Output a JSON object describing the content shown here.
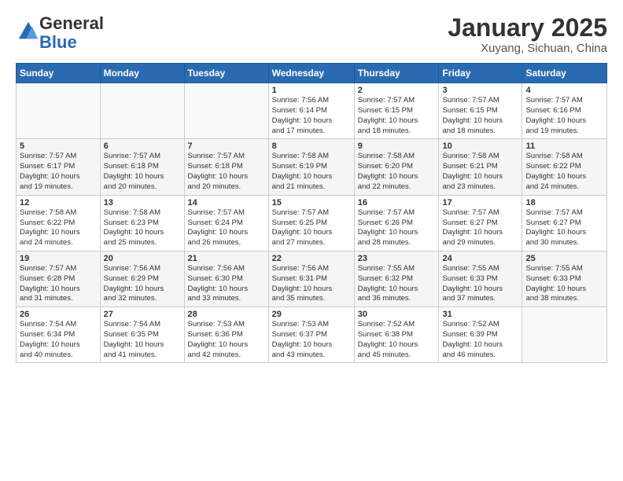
{
  "header": {
    "logo_general": "General",
    "logo_blue": "Blue",
    "title": "January 2025",
    "subtitle": "Xuyang, Sichuan, China"
  },
  "weekdays": [
    "Sunday",
    "Monday",
    "Tuesday",
    "Wednesday",
    "Thursday",
    "Friday",
    "Saturday"
  ],
  "weeks": [
    [
      {
        "day": "",
        "info": ""
      },
      {
        "day": "",
        "info": ""
      },
      {
        "day": "",
        "info": ""
      },
      {
        "day": "1",
        "info": "Sunrise: 7:56 AM\nSunset: 6:14 PM\nDaylight: 10 hours\nand 17 minutes."
      },
      {
        "day": "2",
        "info": "Sunrise: 7:57 AM\nSunset: 6:15 PM\nDaylight: 10 hours\nand 18 minutes."
      },
      {
        "day": "3",
        "info": "Sunrise: 7:57 AM\nSunset: 6:15 PM\nDaylight: 10 hours\nand 18 minutes."
      },
      {
        "day": "4",
        "info": "Sunrise: 7:57 AM\nSunset: 6:16 PM\nDaylight: 10 hours\nand 19 minutes."
      }
    ],
    [
      {
        "day": "5",
        "info": "Sunrise: 7:57 AM\nSunset: 6:17 PM\nDaylight: 10 hours\nand 19 minutes."
      },
      {
        "day": "6",
        "info": "Sunrise: 7:57 AM\nSunset: 6:18 PM\nDaylight: 10 hours\nand 20 minutes."
      },
      {
        "day": "7",
        "info": "Sunrise: 7:57 AM\nSunset: 6:18 PM\nDaylight: 10 hours\nand 20 minutes."
      },
      {
        "day": "8",
        "info": "Sunrise: 7:58 AM\nSunset: 6:19 PM\nDaylight: 10 hours\nand 21 minutes."
      },
      {
        "day": "9",
        "info": "Sunrise: 7:58 AM\nSunset: 6:20 PM\nDaylight: 10 hours\nand 22 minutes."
      },
      {
        "day": "10",
        "info": "Sunrise: 7:58 AM\nSunset: 6:21 PM\nDaylight: 10 hours\nand 23 minutes."
      },
      {
        "day": "11",
        "info": "Sunrise: 7:58 AM\nSunset: 6:22 PM\nDaylight: 10 hours\nand 24 minutes."
      }
    ],
    [
      {
        "day": "12",
        "info": "Sunrise: 7:58 AM\nSunset: 6:22 PM\nDaylight: 10 hours\nand 24 minutes."
      },
      {
        "day": "13",
        "info": "Sunrise: 7:58 AM\nSunset: 6:23 PM\nDaylight: 10 hours\nand 25 minutes."
      },
      {
        "day": "14",
        "info": "Sunrise: 7:57 AM\nSunset: 6:24 PM\nDaylight: 10 hours\nand 26 minutes."
      },
      {
        "day": "15",
        "info": "Sunrise: 7:57 AM\nSunset: 6:25 PM\nDaylight: 10 hours\nand 27 minutes."
      },
      {
        "day": "16",
        "info": "Sunrise: 7:57 AM\nSunset: 6:26 PM\nDaylight: 10 hours\nand 28 minutes."
      },
      {
        "day": "17",
        "info": "Sunrise: 7:57 AM\nSunset: 6:27 PM\nDaylight: 10 hours\nand 29 minutes."
      },
      {
        "day": "18",
        "info": "Sunrise: 7:57 AM\nSunset: 6:27 PM\nDaylight: 10 hours\nand 30 minutes."
      }
    ],
    [
      {
        "day": "19",
        "info": "Sunrise: 7:57 AM\nSunset: 6:28 PM\nDaylight: 10 hours\nand 31 minutes."
      },
      {
        "day": "20",
        "info": "Sunrise: 7:56 AM\nSunset: 6:29 PM\nDaylight: 10 hours\nand 32 minutes."
      },
      {
        "day": "21",
        "info": "Sunrise: 7:56 AM\nSunset: 6:30 PM\nDaylight: 10 hours\nand 33 minutes."
      },
      {
        "day": "22",
        "info": "Sunrise: 7:56 AM\nSunset: 6:31 PM\nDaylight: 10 hours\nand 35 minutes."
      },
      {
        "day": "23",
        "info": "Sunrise: 7:55 AM\nSunset: 6:32 PM\nDaylight: 10 hours\nand 36 minutes."
      },
      {
        "day": "24",
        "info": "Sunrise: 7:55 AM\nSunset: 6:33 PM\nDaylight: 10 hours\nand 37 minutes."
      },
      {
        "day": "25",
        "info": "Sunrise: 7:55 AM\nSunset: 6:33 PM\nDaylight: 10 hours\nand 38 minutes."
      }
    ],
    [
      {
        "day": "26",
        "info": "Sunrise: 7:54 AM\nSunset: 6:34 PM\nDaylight: 10 hours\nand 40 minutes."
      },
      {
        "day": "27",
        "info": "Sunrise: 7:54 AM\nSunset: 6:35 PM\nDaylight: 10 hours\nand 41 minutes."
      },
      {
        "day": "28",
        "info": "Sunrise: 7:53 AM\nSunset: 6:36 PM\nDaylight: 10 hours\nand 42 minutes."
      },
      {
        "day": "29",
        "info": "Sunrise: 7:53 AM\nSunset: 6:37 PM\nDaylight: 10 hours\nand 43 minutes."
      },
      {
        "day": "30",
        "info": "Sunrise: 7:52 AM\nSunset: 6:38 PM\nDaylight: 10 hours\nand 45 minutes."
      },
      {
        "day": "31",
        "info": "Sunrise: 7:52 AM\nSunset: 6:39 PM\nDaylight: 10 hours\nand 46 minutes."
      },
      {
        "day": "",
        "info": ""
      }
    ]
  ]
}
